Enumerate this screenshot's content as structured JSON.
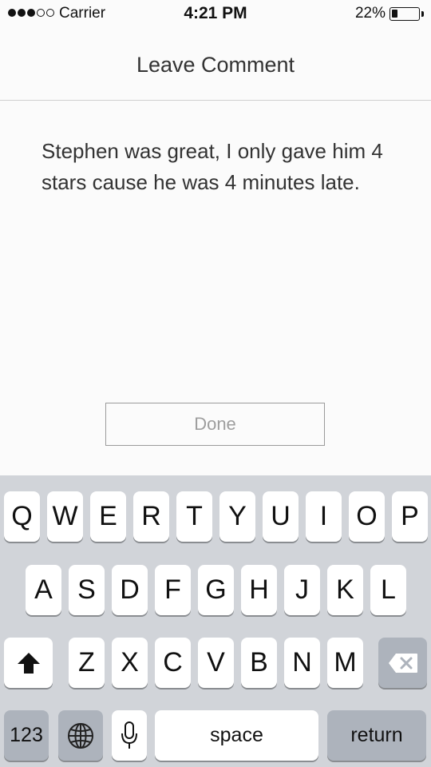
{
  "status_bar": {
    "carrier": "Carrier",
    "time": "4:21 PM",
    "battery_percent": "22%",
    "battery_level": 0.22,
    "signal_bars_filled": 3,
    "signal_bars_total": 5
  },
  "header": {
    "title": "Leave Comment"
  },
  "comment": {
    "text": "Stephen was great, I only gave him 4 stars cause he was 4 minutes late."
  },
  "done_button": {
    "label": "Done"
  },
  "keyboard": {
    "row1": [
      "Q",
      "W",
      "E",
      "R",
      "T",
      "Y",
      "U",
      "I",
      "O",
      "P"
    ],
    "row2": [
      "A",
      "S",
      "D",
      "F",
      "G",
      "H",
      "J",
      "K",
      "L"
    ],
    "row3": [
      "Z",
      "X",
      "C",
      "V",
      "B",
      "N",
      "M"
    ],
    "numbers_label": "123",
    "space_label": "space",
    "return_label": "return",
    "icons": {
      "shift": "shift-arrow-icon",
      "delete": "backspace-icon",
      "globe": "globe-icon",
      "mic": "microphone-icon"
    }
  },
  "colors": {
    "background": "#fbfbfb",
    "keyboard_bg": "#d1d4d9",
    "dark_key": "#adb3bc",
    "key": "#ffffff"
  }
}
